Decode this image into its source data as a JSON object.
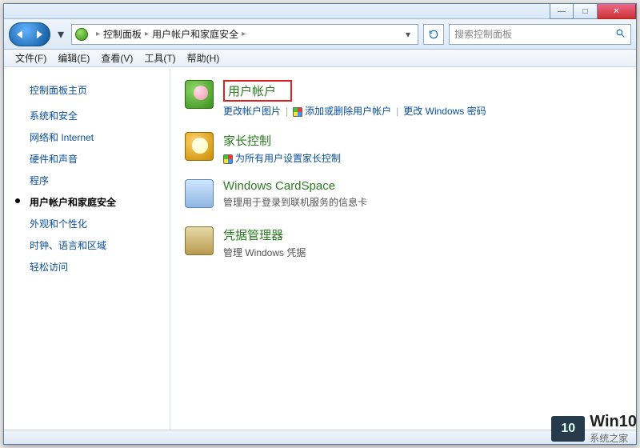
{
  "window": {
    "controls": {
      "min": "—",
      "max": "□",
      "close": "✕"
    }
  },
  "addr": {
    "breadcrumb": [
      "控制面板",
      "用户帐户和家庭安全"
    ],
    "search_placeholder": "搜索控制面板"
  },
  "menu": [
    "文件(F)",
    "编辑(E)",
    "查看(V)",
    "工具(T)",
    "帮助(H)"
  ],
  "sidebar": {
    "title": "控制面板主页",
    "items": [
      {
        "label": "系统和安全",
        "active": false
      },
      {
        "label": "网络和 Internet",
        "active": false
      },
      {
        "label": "硬件和声音",
        "active": false
      },
      {
        "label": "程序",
        "active": false
      },
      {
        "label": "用户帐户和家庭安全",
        "active": true
      },
      {
        "label": "外观和个性化",
        "active": false
      },
      {
        "label": "时钟、语言和区域",
        "active": false
      },
      {
        "label": "轻松访问",
        "active": false
      }
    ]
  },
  "categories": [
    {
      "key": "user_accounts",
      "icon": "ic-users",
      "title": "用户帐户",
      "highlighted": true,
      "sub": null,
      "links": [
        {
          "text": "更改帐户图片",
          "shield": false
        },
        {
          "text": "添加或删除用户帐户",
          "shield": true
        },
        {
          "text": "更改 Windows 密码",
          "shield": false
        }
      ]
    },
    {
      "key": "parental",
      "icon": "ic-parental",
      "title": "家长控制",
      "highlighted": false,
      "sub": null,
      "links": [
        {
          "text": "为所有用户设置家长控制",
          "shield": true
        }
      ]
    },
    {
      "key": "cardspace",
      "icon": "ic-cardspace",
      "title": "Windows CardSpace",
      "highlighted": false,
      "sub": "管理用于登录到联机服务的信息卡",
      "links": []
    },
    {
      "key": "cred",
      "icon": "ic-cred",
      "title": "凭据管理器",
      "highlighted": false,
      "sub": "管理 Windows 凭据",
      "links": []
    }
  ],
  "watermark": {
    "big": "10",
    "line1": "Win10",
    "line2": "系统之家"
  }
}
